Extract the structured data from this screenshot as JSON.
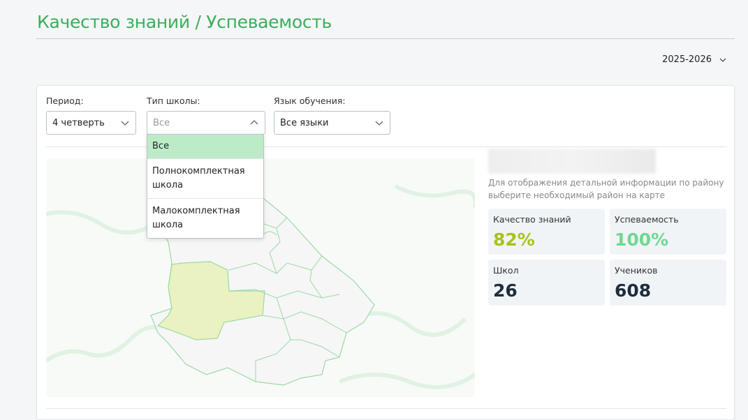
{
  "header": {
    "title": "Качество знаний / Успеваемость",
    "year": "2025-2026"
  },
  "filters": {
    "period": {
      "label": "Период:",
      "value": "4 четверть"
    },
    "school_type": {
      "label": "Тип школы:",
      "placeholder": "Все",
      "options": [
        "Все",
        "Полнокомплектная школа",
        "Малокомплектная школа"
      ],
      "selected": "Все"
    },
    "language": {
      "label": "Язык обучения:",
      "value": "Все языки"
    }
  },
  "info": {
    "hint": "Для отображения детальной информации по району выберите необходимый район на карте",
    "stats": [
      {
        "label": "Качество знаний",
        "value": "82%",
        "color": "#a8c21a"
      },
      {
        "label": "Успеваемость",
        "value": "100%",
        "color": "#6fd88f"
      },
      {
        "label": "Школ",
        "value": "26",
        "color": "#1f2d3d"
      },
      {
        "label": "Учеников",
        "value": "608",
        "color": "#1f2d3d"
      }
    ]
  },
  "colors": {
    "accent": "#3aaf5b",
    "selected_option": "#bdebc8",
    "region_highlight": "#eaf2c2",
    "region_border": "#9ad9a6"
  }
}
